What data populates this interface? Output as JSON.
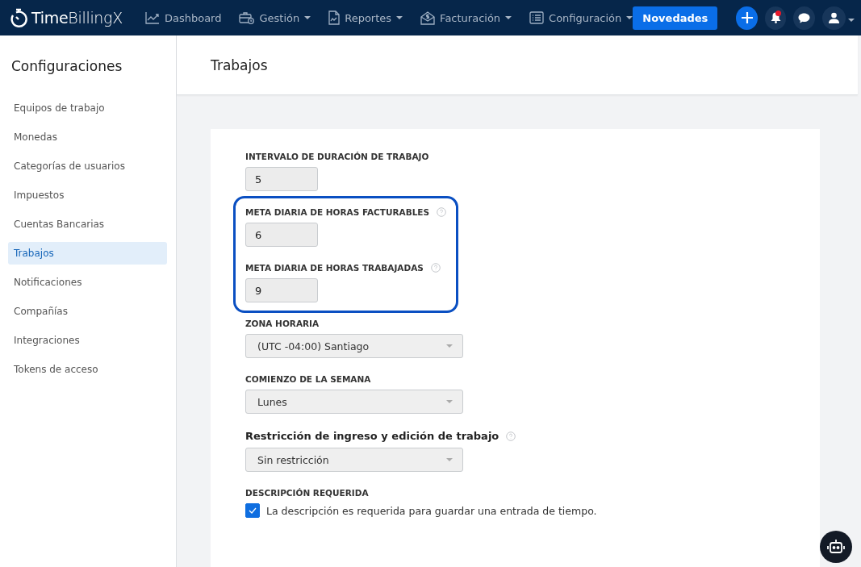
{
  "topbar": {
    "logo": "**Time**BillingX",
    "nav": [
      {
        "label": "Dashboard",
        "has_menu": false
      },
      {
        "label": "Gestión",
        "has_menu": true
      },
      {
        "label": "Reportes",
        "has_menu": true
      },
      {
        "label": "Facturación",
        "has_menu": true
      },
      {
        "label": "Configuración",
        "has_menu": true
      }
    ],
    "news_button": "Novedades",
    "notifications_unread": true,
    "user_menu": true
  },
  "sidebar": {
    "title": "Configuraciones",
    "items": [
      {
        "label": "Equipos de trabajo",
        "selected": false
      },
      {
        "label": "Monedas",
        "selected": false
      },
      {
        "label": "Categorías de usuarios",
        "selected": false
      },
      {
        "label": "Impuestos",
        "selected": false
      },
      {
        "label": "Cuentas Bancarias",
        "selected": false
      },
      {
        "label": "Trabajos",
        "selected": true
      },
      {
        "label": "Notificaciones",
        "selected": false
      },
      {
        "label": "Compañías",
        "selected": false
      },
      {
        "label": "Integraciones",
        "selected": false
      },
      {
        "label": "Tokens de acceso",
        "selected": false
      }
    ]
  },
  "page": {
    "title": "Trabajos",
    "groups": [
      {
        "highlighted": false,
        "fields": [
          {
            "kind": "text",
            "label": "INTERVALO DE DURACIÓN DE TRABAJO",
            "help": false,
            "large_label": false,
            "value": "5"
          }
        ]
      },
      {
        "highlighted": true,
        "fields": [
          {
            "kind": "text",
            "label": "META DIARIA DE HORAS FACTURABLES",
            "help": true,
            "large_label": false,
            "value": "6"
          },
          {
            "kind": "text",
            "label": "META DIARIA DE HORAS TRABAJADAS",
            "help": true,
            "large_label": false,
            "value": "9"
          }
        ]
      },
      {
        "highlighted": false,
        "fields": [
          {
            "kind": "select",
            "label": "ZONA HORARIA",
            "help": false,
            "large_label": false,
            "value": "(UTC -04:00) Santiago"
          },
          {
            "kind": "select",
            "label": "COMIENZO DE LA SEMANA",
            "help": false,
            "large_label": false,
            "value": "Lunes"
          },
          {
            "kind": "select",
            "label": "Restricción de ingreso y edición de trabajo",
            "help": true,
            "large_label": true,
            "value": "Sin restricción"
          },
          {
            "kind": "checkbox",
            "label": "DESCRIPCIÓN REQUERIDA",
            "help": false,
            "large_label": false,
            "value": "La descripción es requerida para guardar una entrada de tiempo.",
            "checked": true
          }
        ]
      }
    ]
  }
}
